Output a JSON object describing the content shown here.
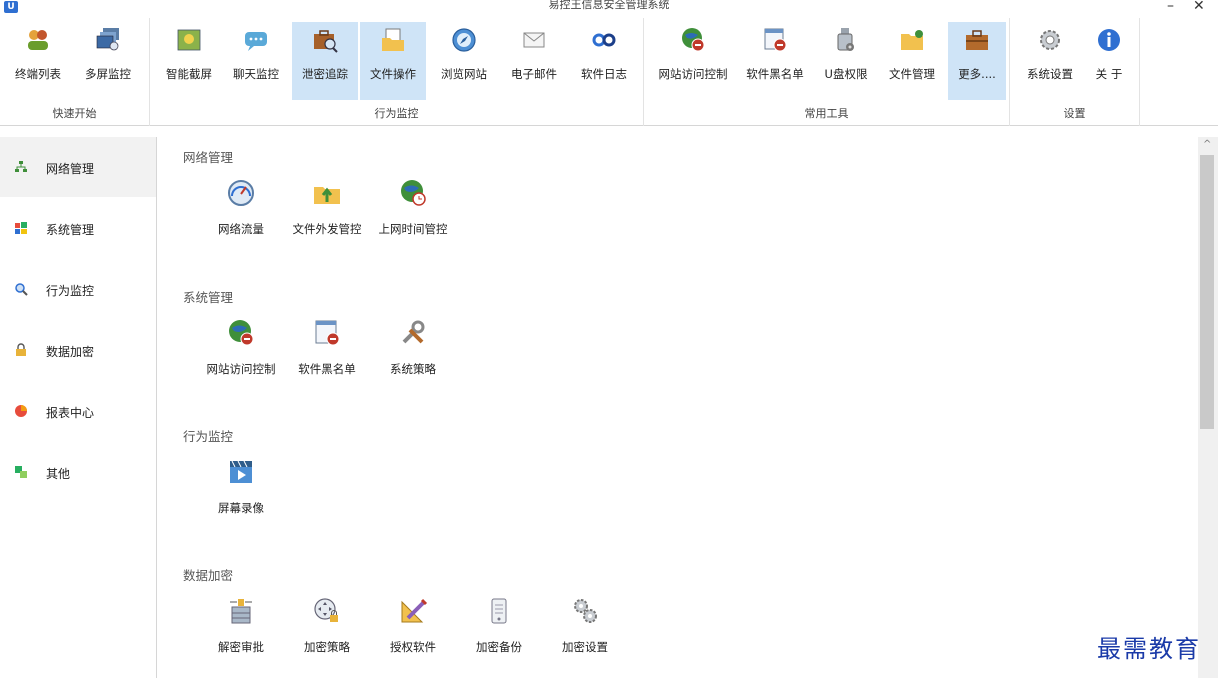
{
  "window": {
    "title": "易控王信息安全管理系统",
    "minimize": "–",
    "close": "✕"
  },
  "ribbon": {
    "groups": [
      {
        "label": "快速开始",
        "items": [
          {
            "label": "终端列表",
            "icon": "users-icon"
          },
          {
            "label": "多屏监控",
            "icon": "multi-screen-icon"
          }
        ]
      },
      {
        "label": "行为监控",
        "items": [
          {
            "label": "智能截屏",
            "icon": "screenshot-icon"
          },
          {
            "label": "聊天监控",
            "icon": "chat-icon"
          },
          {
            "label": "泄密追踪",
            "icon": "leak-track-icon",
            "active": true
          },
          {
            "label": "文件操作",
            "icon": "file-operation-icon",
            "active": true
          },
          {
            "label": "浏览网站",
            "icon": "browser-icon"
          },
          {
            "label": "电子邮件",
            "icon": "email-icon"
          },
          {
            "label": "软件日志",
            "icon": "software-log-icon"
          }
        ]
      },
      {
        "label": "常用工具",
        "items": [
          {
            "label": "网站访问控制",
            "icon": "globe-block-icon"
          },
          {
            "label": "软件黑名单",
            "icon": "software-blacklist-icon"
          },
          {
            "label": "U盘权限",
            "icon": "usb-permission-icon"
          },
          {
            "label": "文件管理",
            "icon": "folder-manage-icon"
          },
          {
            "label": "更多....",
            "icon": "toolbox-icon",
            "active": true
          }
        ]
      },
      {
        "label": "设置",
        "items": [
          {
            "label": "系统设置",
            "icon": "gear-icon"
          },
          {
            "label": "关 于",
            "icon": "info-icon"
          }
        ]
      }
    ]
  },
  "sidebar": {
    "items": [
      {
        "label": "网络管理",
        "icon": "network-icon",
        "active": true
      },
      {
        "label": "系统管理",
        "icon": "windows-icon"
      },
      {
        "label": "行为监控",
        "icon": "magnifier-icon"
      },
      {
        "label": "数据加密",
        "icon": "lock-icon"
      },
      {
        "label": "报表中心",
        "icon": "report-icon"
      },
      {
        "label": "其他",
        "icon": "other-icon"
      }
    ]
  },
  "main": {
    "sections": [
      {
        "title": "网络管理",
        "tiles": [
          {
            "label": "网络流量",
            "icon": "speedometer-icon"
          },
          {
            "label": "文件外发管控",
            "icon": "folder-upload-icon"
          },
          {
            "label": "上网时间管控",
            "icon": "globe-clock-icon"
          }
        ]
      },
      {
        "title": "系统管理",
        "tiles": [
          {
            "label": "网站访问控制",
            "icon": "globe-block-icon"
          },
          {
            "label": "软件黑名单",
            "icon": "software-blacklist-icon"
          },
          {
            "label": "系统策略",
            "icon": "tools-icon"
          }
        ]
      },
      {
        "title": "行为监控",
        "tiles": [
          {
            "label": "屏幕录像",
            "icon": "screen-record-icon"
          }
        ]
      },
      {
        "title": "数据加密",
        "tiles": [
          {
            "label": "解密审批",
            "icon": "decrypt-approve-icon"
          },
          {
            "label": "加密策略",
            "icon": "encrypt-policy-icon"
          },
          {
            "label": "授权软件",
            "icon": "authorize-software-icon"
          },
          {
            "label": "加密备份",
            "icon": "encrypt-backup-icon"
          },
          {
            "label": "加密设置",
            "icon": "encrypt-settings-icon"
          }
        ]
      }
    ]
  },
  "watermark": "最需教育",
  "colors": {
    "active_bg": "#cfe4f7",
    "accent_blue": "#2f6fd1",
    "watermark": "#1a3aa8"
  }
}
